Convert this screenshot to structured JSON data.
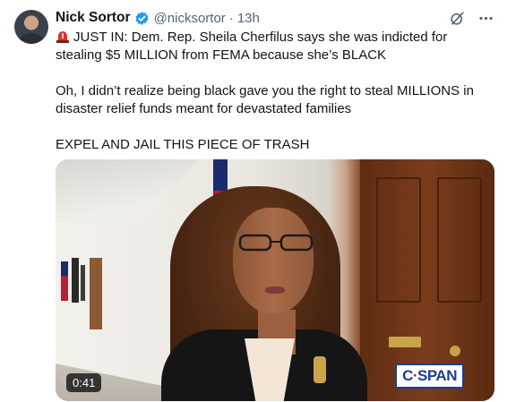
{
  "author": {
    "name": "Nick Sortor",
    "handle": "@nicksortor",
    "separator": "·",
    "time": "13h",
    "verified": true,
    "avatar_icon": "avatar-photo"
  },
  "icons": {
    "verified": "verified-badge-icon",
    "grok": "grok-icon",
    "more": "more-options-icon",
    "siren": "siren-icon"
  },
  "tweet": {
    "line1": "JUST IN: Dem. Rep. Sheila Cherfilus says she was indicted for stealing $5 MILLION from FEMA because she’s BLACK",
    "line2": "Oh, I didn’t realize being black gave you the right to steal MILLIONS in disaster relief funds meant for devastated families",
    "line3": "EXPEL AND JAIL THIS PIECE OF TRASH"
  },
  "media": {
    "duration": "0:41",
    "watermark_left": "C",
    "watermark_sep": "·",
    "watermark_right": "SPAN"
  },
  "colors": {
    "accent": "#1d9bf0",
    "muted": "#536471",
    "text": "#0f1419"
  }
}
